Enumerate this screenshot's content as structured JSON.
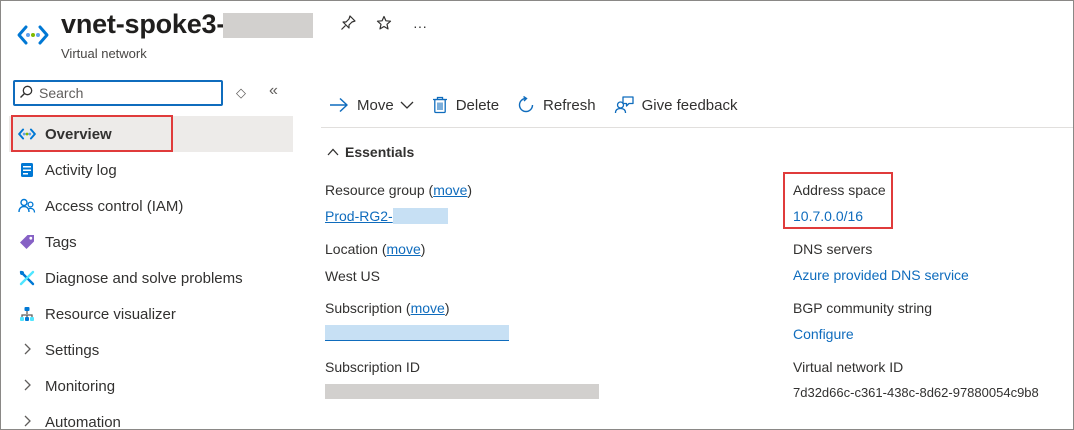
{
  "header": {
    "title": "vnet-spoke3-",
    "subtitle": "Virtual network",
    "actions": {
      "pin_icon": "pin-icon",
      "favorite_icon": "star-icon",
      "more_label": "···"
    }
  },
  "sidebar": {
    "search": {
      "placeholder": "Search",
      "value": ""
    },
    "controls": {
      "filter_label": "◇",
      "collapse_label": "«"
    },
    "items": [
      {
        "label": "Overview",
        "icon": "virtual-network-icon",
        "active": true
      },
      {
        "label": "Activity log",
        "icon": "activity-log-icon"
      },
      {
        "label": "Access control (IAM)",
        "icon": "people-icon"
      },
      {
        "label": "Tags",
        "icon": "tag-icon"
      },
      {
        "label": "Diagnose and solve problems",
        "icon": "wrench-icon"
      },
      {
        "label": "Resource visualizer",
        "icon": "hierarchy-icon"
      },
      {
        "label": "Settings",
        "icon": "chevron-right-icon"
      },
      {
        "label": "Monitoring",
        "icon": "chevron-right-icon"
      },
      {
        "label": "Automation",
        "icon": "chevron-right-icon"
      }
    ]
  },
  "toolbar": {
    "move": "Move",
    "delete": "Delete",
    "refresh": "Refresh",
    "feedback": "Give feedback"
  },
  "essentials": {
    "header": "Essentials",
    "left": {
      "resource_group_label": "Resource group",
      "resource_group_move": "move",
      "resource_group_value": "Prod-RG2-",
      "location_label": "Location",
      "location_move": "move",
      "location_value": "West US",
      "subscription_label": "Subscription",
      "subscription_move": "move",
      "subscription_id_label": "Subscription ID"
    },
    "right": {
      "address_space_label": "Address space",
      "address_space_value": "10.7.0.0/16",
      "dns_label": "DNS servers",
      "dns_value": "Azure provided DNS service",
      "bgp_label": "BGP community string",
      "bgp_value": "Configure",
      "vnet_id_label": "Virtual network ID",
      "vnet_id_value": "7d32d66c-c361-438c-8d62-97880054c9b8"
    }
  },
  "colors": {
    "accent": "#0f6cbd",
    "highlight": "#e03b3b",
    "redaction": "#d2d0ce"
  }
}
